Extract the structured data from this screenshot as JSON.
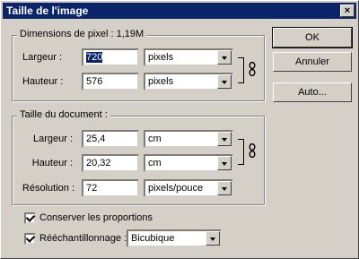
{
  "window": {
    "title": "Taille de l'image",
    "close": "×"
  },
  "pixel_dims": {
    "legend": "Dimensions de pixel :",
    "size": "1,19M",
    "width_label": "Largeur :",
    "width_value": "720",
    "width_unit": "pixels",
    "height_label": "Hauteur :",
    "height_value": "576",
    "height_unit": "pixels"
  },
  "doc_size": {
    "legend": "Taille du document :",
    "width_label": "Largeur :",
    "width_value": "25,4",
    "width_unit": "cm",
    "height_label": "Hauteur :",
    "height_value": "20,32",
    "height_unit": "cm",
    "res_label": "Résolution :",
    "res_value": "72",
    "res_unit": "pixels/pouce"
  },
  "buttons": {
    "ok": "OK",
    "cancel": "Annuler",
    "auto": "Auto..."
  },
  "options": {
    "constrain_label": "Conserver les proportions",
    "constrain_checked": true,
    "resample_label": "Rééchantillonnage :",
    "resample_checked": true,
    "resample_method": "Bicubique"
  }
}
